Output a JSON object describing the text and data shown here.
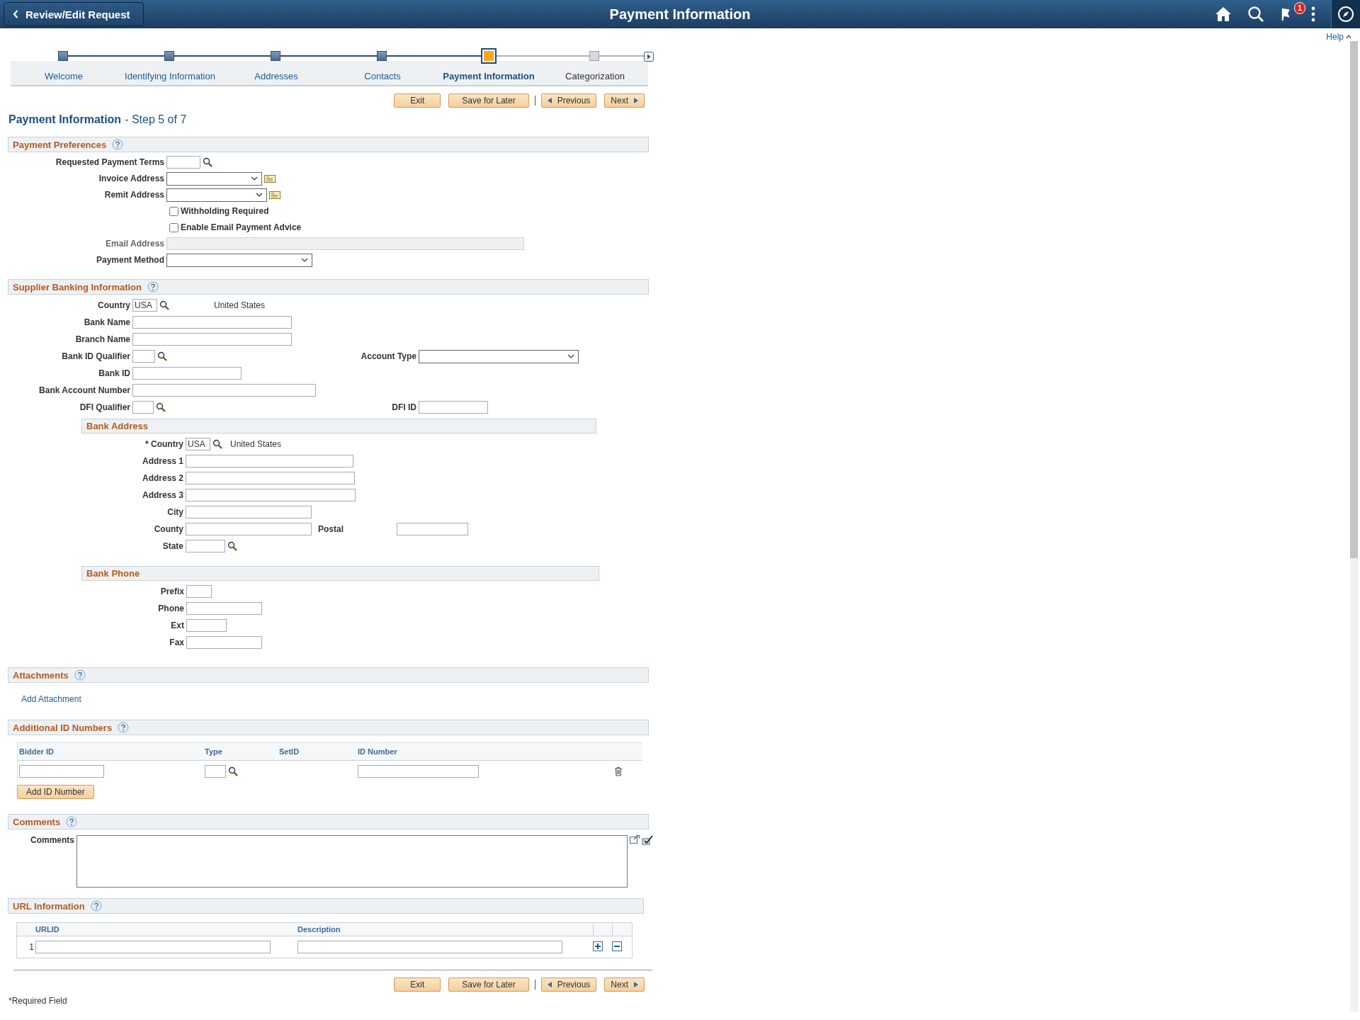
{
  "header": {
    "back_button": "Review/Edit Request",
    "title": "Payment Information",
    "notification_count": "1"
  },
  "help_link": "Help",
  "steps": [
    {
      "label": "Welcome",
      "selected": false
    },
    {
      "label": "Identifying Information",
      "selected": false
    },
    {
      "label": "Addresses",
      "selected": false
    },
    {
      "label": "Contacts",
      "selected": false
    },
    {
      "label": "Payment Information",
      "selected": true
    },
    {
      "label": "Categorization",
      "selected": false
    }
  ],
  "nav_buttons": [
    {
      "label": "Exit",
      "kind": "plain"
    },
    {
      "label": "Save for Later",
      "kind": "plain"
    },
    {
      "label": "Previous",
      "kind": "back"
    },
    {
      "label": "Next",
      "kind": "forward"
    }
  ],
  "page_title": "Payment Information",
  "step_text": "- Step 5 of 7",
  "payment_preferences": {
    "title": "Payment Preferences",
    "rows": [
      {
        "fields": [
          {
            "kind": "lookup",
            "label": "Requested Payment Terms"
          }
        ]
      },
      {
        "fields": [
          {
            "kind": "address",
            "label": "Invoice Address"
          }
        ]
      },
      {
        "fields": [
          {
            "kind": "address",
            "label": "Remit Address"
          }
        ]
      },
      {
        "fields": [
          {
            "kind": "checkbox",
            "label": "Withholding Required",
            "checked": false
          }
        ]
      },
      {
        "fields": [
          {
            "kind": "checkbox",
            "label": "Enable Email Payment Advice",
            "checked": false
          }
        ]
      },
      {
        "fields": [
          {
            "kind": "text",
            "label": "Email Address",
            "disabled": true
          }
        ]
      },
      {
        "fields": [
          {
            "kind": "select",
            "label": "Payment Method"
          }
        ]
      }
    ]
  },
  "supplier_banking": {
    "title": "Supplier Banking Information",
    "rows": [
      {
        "fields": [
          {
            "kind": "lookup",
            "label": "Country",
            "value": "USA",
            "description": "United States"
          }
        ]
      },
      {
        "fields": [
          {
            "kind": "text",
            "label": "Bank Name"
          }
        ]
      },
      {
        "fields": [
          {
            "kind": "text",
            "label": "Branch Name"
          }
        ]
      },
      {
        "fields": [
          {
            "kind": "lookup",
            "label": "Bank ID Qualifier"
          },
          {
            "kind": "select",
            "label": "Account Type"
          }
        ]
      },
      {
        "fields": [
          {
            "kind": "text",
            "label": "Bank ID"
          }
        ]
      },
      {
        "fields": [
          {
            "kind": "text",
            "label": "Bank Account Number"
          }
        ]
      },
      {
        "fields": [
          {
            "kind": "lookup",
            "label": "DFI Qualifier"
          },
          {
            "kind": "text",
            "label": "DFI ID"
          }
        ]
      }
    ],
    "bank_address": {
      "title": "Bank Address",
      "rows": [
        {
          "fields": [
            {
              "kind": "lookup",
              "label": "* Country",
              "value": "USA",
              "description": "United States"
            }
          ]
        },
        {
          "fields": [
            {
              "kind": "text",
              "label": "Address 1"
            }
          ]
        },
        {
          "fields": [
            {
              "kind": "text",
              "label": "Address 2"
            }
          ]
        },
        {
          "fields": [
            {
              "kind": "text",
              "label": "Address 3"
            }
          ]
        },
        {
          "fields": [
            {
              "kind": "text",
              "label": "City"
            }
          ]
        },
        {
          "fields": [
            {
              "kind": "text",
              "label": "County"
            },
            {
              "kind": "text",
              "label": "Postal"
            }
          ]
        },
        {
          "fields": [
            {
              "kind": "lookup",
              "label": "State"
            }
          ]
        }
      ]
    },
    "bank_phone": {
      "title": "Bank Phone",
      "rows": [
        {
          "fields": [
            {
              "kind": "text",
              "label": "Prefix"
            }
          ]
        },
        {
          "fields": [
            {
              "kind": "text",
              "label": "Phone"
            }
          ]
        },
        {
          "fields": [
            {
              "kind": "text",
              "label": "Ext"
            }
          ]
        },
        {
          "fields": [
            {
              "kind": "text",
              "label": "Fax"
            }
          ]
        }
      ]
    }
  },
  "attachments": {
    "title": "Attachments",
    "link": "Add Attachment"
  },
  "additional_ids": {
    "title": "Additional ID Numbers",
    "columns": [
      "Bidder ID",
      "Type",
      "SetID",
      "ID Number"
    ],
    "add_button": "Add ID Number"
  },
  "comments": {
    "title": "Comments",
    "label": "Comments"
  },
  "url_information": {
    "title": "URL Information",
    "columns": [
      "URLID",
      "Description"
    ],
    "rows": [
      {
        "number": "1"
      }
    ]
  },
  "bottom_nav_buttons": [
    {
      "label": "Exit",
      "kind": "plain"
    },
    {
      "label": "Save for Later",
      "kind": "plain"
    },
    {
      "label": "Previous",
      "kind": "back"
    },
    {
      "label": "Next",
      "kind": "forward"
    }
  ],
  "footnote": "*Required Field"
}
